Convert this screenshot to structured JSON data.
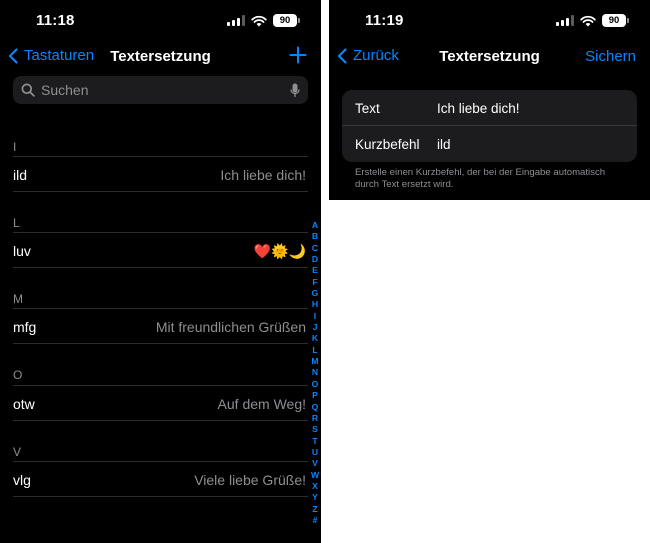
{
  "list_screen": {
    "status": {
      "time": "11:18",
      "battery": "90"
    },
    "nav": {
      "back_label": "Tastaturen",
      "title": "Textersetzung",
      "add_icon": "plus-icon"
    },
    "search": {
      "placeholder": "Suchen",
      "value": ""
    },
    "sections": [
      {
        "header": "I",
        "rows": [
          {
            "shortcut": "ild",
            "phrase": "Ich liebe dich!"
          }
        ]
      },
      {
        "header": "L",
        "rows": [
          {
            "shortcut": "luv",
            "phrase": "❤️🌞🌙"
          }
        ]
      },
      {
        "header": "M",
        "rows": [
          {
            "shortcut": "mfg",
            "phrase": "Mit freundlichen Grüßen"
          }
        ]
      },
      {
        "header": "O",
        "rows": [
          {
            "shortcut": "otw",
            "phrase": "Auf dem Weg!"
          }
        ]
      },
      {
        "header": "V",
        "rows": [
          {
            "shortcut": "vlg",
            "phrase": "Viele liebe Grüße!"
          }
        ]
      }
    ],
    "index_letters": [
      "A",
      "B",
      "C",
      "D",
      "E",
      "F",
      "G",
      "H",
      "I",
      "J",
      "K",
      "L",
      "M",
      "N",
      "O",
      "P",
      "Q",
      "R",
      "S",
      "T",
      "U",
      "V",
      "W",
      "X",
      "Y",
      "Z",
      "#"
    ]
  },
  "edit_screen": {
    "status": {
      "time": "11:19",
      "battery": "90"
    },
    "nav": {
      "back_label": "Zurück",
      "title": "Textersetzung",
      "save_label": "Sichern"
    },
    "form": {
      "text_label": "Text",
      "text_value": "Ich liebe dich!",
      "shortcut_label": "Kurzbefehl",
      "shortcut_value": "ild"
    },
    "footer": "Erstelle einen Kurzbefehl, der bei der Eingabe automatisch durch Text ersetzt wird."
  },
  "colors": {
    "accent": "#0a84ff",
    "background": "#000000",
    "secondary_text": "#8e8e93",
    "cell": "#1c1c1e"
  }
}
